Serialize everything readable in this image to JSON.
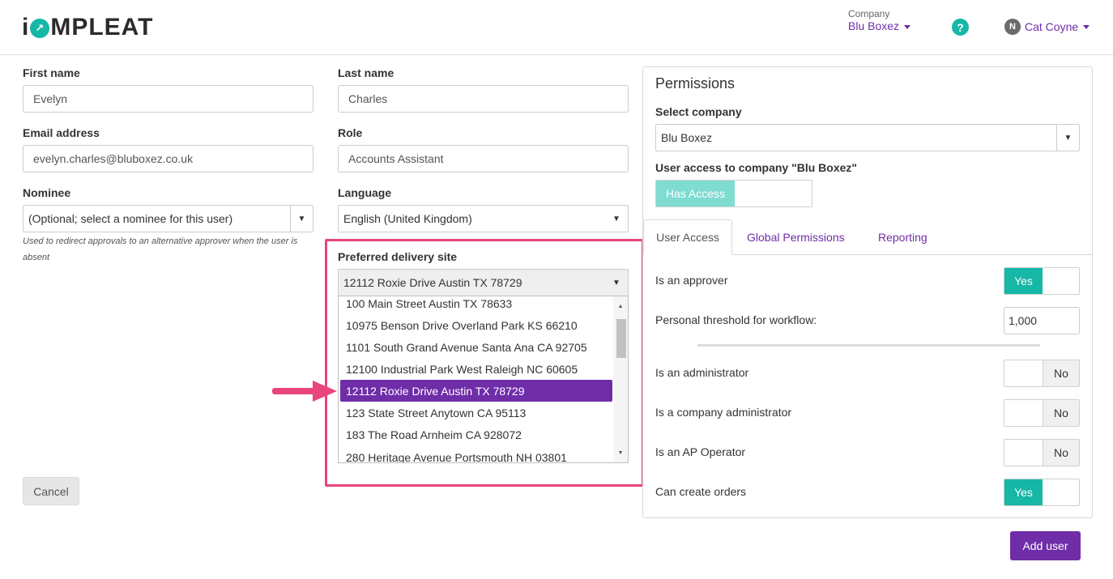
{
  "header": {
    "logo_prefix": "i",
    "logo_mark": "↗",
    "logo_suffix": "MPLEAT",
    "company_label": "Company",
    "company_value": "Blu Boxez",
    "help_icon": "question-circle-icon",
    "help_glyph": "?",
    "user_initial": "N",
    "user_name": "Cat Coyne"
  },
  "form": {
    "first_name_label": "First name",
    "first_name_value": "Evelyn",
    "last_name_label": "Last name",
    "last_name_value": "Charles",
    "email_label": "Email address",
    "email_value": "evelyn.charles@bluboxez.co.uk",
    "role_label": "Role",
    "role_value": "Accounts Assistant",
    "nominee_label": "Nominee",
    "nominee_value": "(Optional; select a nominee for this user)",
    "nominee_hint": "Used to redirect approvals to an alternative approver when the user is absent",
    "language_label": "Language",
    "language_value": "English (United Kingdom)",
    "delivery_label": "Preferred delivery site",
    "delivery_value": "12112 Roxie Drive Austin TX 78729",
    "delivery_options": [
      "100 Main Street Austin TX 78633",
      "10975 Benson Drive Overland Park KS 66210",
      "1101 South Grand Avenue Santa Ana CA 92705",
      "12100 Industrial Park West Raleigh NC 60605",
      "12112 Roxie Drive Austin TX 78729",
      "123 State Street Anytown CA 95113",
      "183 The Road Arnheim CA 928072",
      "280 Heritage Avenue Portsmouth NH 03801"
    ],
    "delivery_selected_index": 4,
    "cancel_label": "Cancel",
    "add_user_label": "Add user"
  },
  "permissions": {
    "title": "Permissions",
    "select_company_label": "Select company",
    "select_company_value": "Blu Boxez",
    "user_access_label": "User access to company \"Blu Boxez\"",
    "has_access_label": "Has Access",
    "tabs": [
      "User Access",
      "Global Permissions",
      "Reporting"
    ],
    "rows": {
      "approver_label": "Is an approver",
      "approver_value": "Yes",
      "threshold_label": "Personal threshold for workflow:",
      "threshold_value": "1,000",
      "admin_label": "Is an administrator",
      "admin_value": "No",
      "company_admin_label": "Is a company administrator",
      "company_admin_value": "No",
      "ap_operator_label": "Is an AP Operator",
      "ap_operator_value": "No",
      "create_orders_label": "Can create orders",
      "create_orders_value": "Yes"
    }
  },
  "colors": {
    "brand_purple": "#6f2da8",
    "brand_teal": "#16b7a6",
    "highlight_pink": "#e8457a"
  }
}
